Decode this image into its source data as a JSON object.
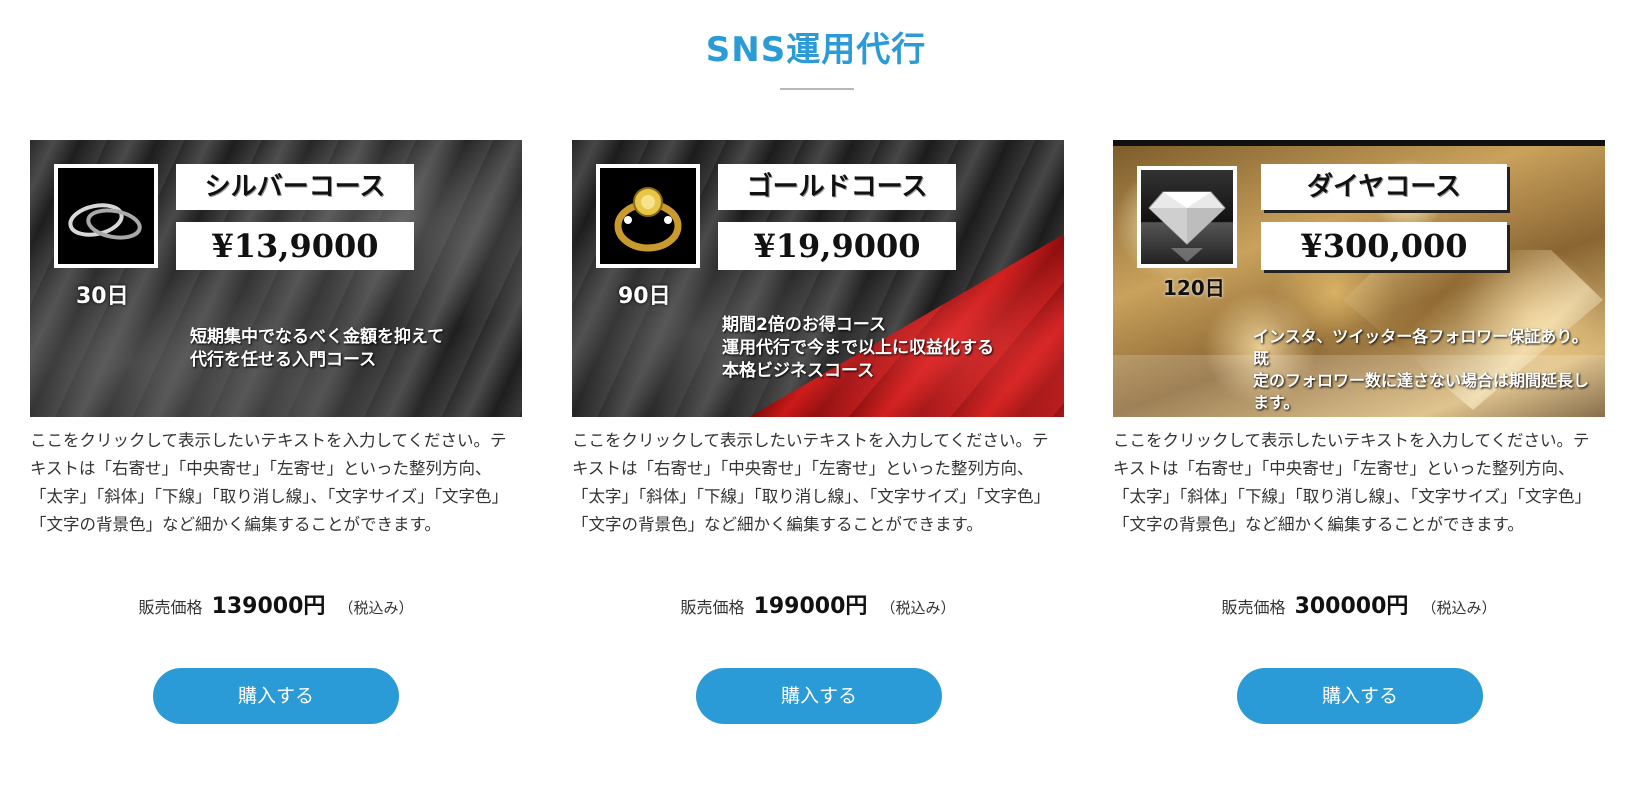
{
  "section": {
    "title": "SNS運用代行"
  },
  "cards": [
    {
      "course_name": "シルバーコース",
      "banner_price": "¥13,9000",
      "days": "30日",
      "banner_text": "短期集中でなるべく金額を抑えて\n代行を任せる入門コース",
      "body": "ここをクリックして表示したいテキストを入力してください。テキストは「右寄せ」「中央寄せ」「左寄せ」といった整列方向、「太字」「斜体」「下線」「取り消し線」、「文字サイズ」「文字色」「文字の背景色」など細かく編集することができます。",
      "price_label": "販売価格",
      "price": "139000円",
      "tax": "（税込み）",
      "button": "購入する",
      "icon": "ring-icon"
    },
    {
      "course_name": "ゴールドコース",
      "banner_price": "¥19,9000",
      "days": "90日",
      "banner_text": "期間2倍のお得コース\n運用代行で今まで以上に収益化する\n本格ビジネスコース",
      "body": "ここをクリックして表示したいテキストを入力してください。テキストは「右寄せ」「中央寄せ」「左寄せ」といった整列方向、「太字」「斜体」「下線」「取り消し線」、「文字サイズ」「文字色」「文字の背景色」など細かく編集することができます。",
      "price_label": "販売価格",
      "price": "199000円",
      "tax": "（税込み）",
      "button": "購入する",
      "icon": "gold-ring-icon"
    },
    {
      "course_name": "ダイヤコース",
      "banner_price": "¥300,000",
      "days": "120日",
      "banner_text": "インスタ、ツイッター各フォロワー保証あり。既\n定のフォロワー数に達さない場合は期間延長し\nます。",
      "body": "ここをクリックして表示したいテキストを入力してください。テキストは「右寄せ」「中央寄せ」「左寄せ」といった整列方向、「太字」「斜体」「下線」「取り消し線」、「文字サイズ」「文字色」「文字の背景色」など細かく編集することができます。",
      "price_label": "販売価格",
      "price": "300000円",
      "tax": "（税込み）",
      "button": "購入する",
      "icon": "diamond-icon"
    }
  ],
  "colors": {
    "accent": "#2a9bd6",
    "rule": "#b8b8b8",
    "text": "#333333"
  }
}
